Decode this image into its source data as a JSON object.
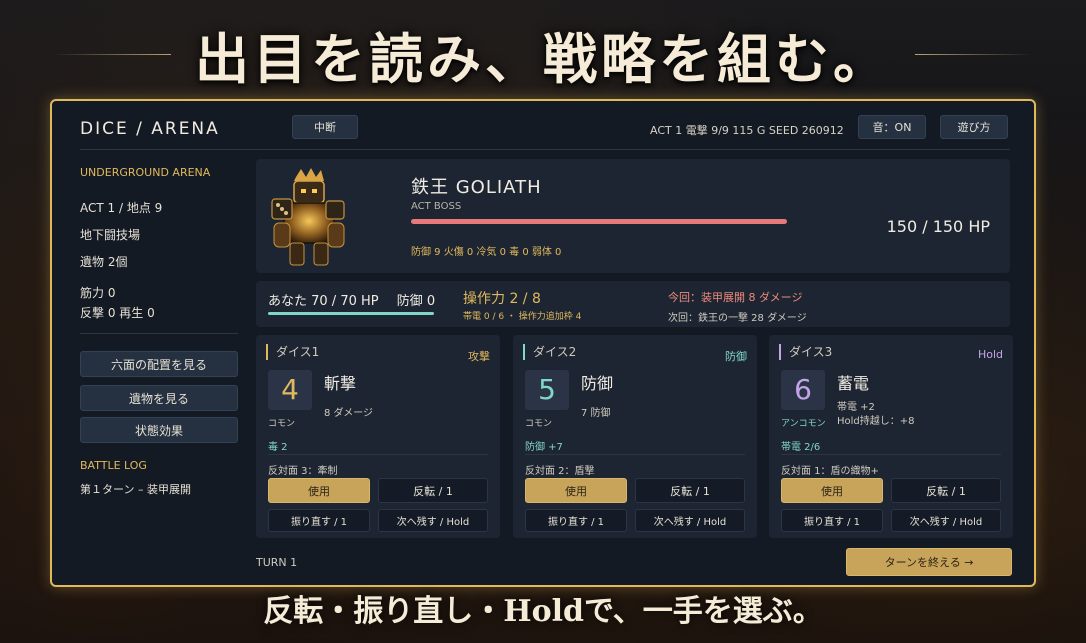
{
  "headline": "出目を読み、戦略を組む。",
  "footline": "反転・振り直し・Holdで、一手を選ぶ。",
  "topbar": {
    "brand": "DICE  /  ARENA",
    "pause_label": "中断",
    "stats": "ACT 1  電撃 9/9  115 G   SEED 260912",
    "sound_label": "音：ON",
    "help_label": "遊び方"
  },
  "sidebar": {
    "arena_label": "UNDERGROUND ARENA",
    "act": "ACT 1 / 地点 9",
    "location": "地下闘技場",
    "relics": "遺物 2個",
    "strength": "筋力 0",
    "counter_regen": "反撃 0  再生 0",
    "buttons": [
      "六面の配置を見る",
      "遺物を見る",
      "状態効果"
    ],
    "battle_log_label": "BATTLE LOG",
    "log": [
      "第１ターン – 装甲展開"
    ]
  },
  "enemy": {
    "name": "鉄王  GOLIATH",
    "subtitle": "ACT BOSS",
    "hp_text": "150 / 150 HP",
    "hp_fraction": 1.0,
    "status": "防御 9   火傷 0   冷気 0   毒 0   弱体 0",
    "portrait_icon": "armored-dice-king-icon"
  },
  "player": {
    "hp_label": "あなた  70 / 70 HP",
    "defense_label": "防御 0",
    "hp_fraction": 1.0,
    "ops_label": "操作力  2 / 8",
    "ops_sub": "帯電 0 / 6  ・ 操作力追加枠 4",
    "intent_now": "今回：装甲展開  8 ダメージ",
    "intent_next": "次回：鉄王の一撃  28 ダメージ"
  },
  "dice": [
    {
      "title": "ダイス1",
      "type": "攻撃",
      "value": "4",
      "rarity": "コモン",
      "skill": "斬撃",
      "effects": [
        "8 ダメージ"
      ],
      "tag": "毒 2",
      "opposite": "反対面 3：牽制",
      "use": "使用",
      "flip": "反転  / 1",
      "reroll": "振り直す / 1",
      "hold": "次へ残す / Hold",
      "accent": "#e0b95c",
      "value_color": "#e0b95c",
      "rarity_color": "#cfcabc"
    },
    {
      "title": "ダイス2",
      "type": "防御",
      "value": "5",
      "rarity": "コモン",
      "skill": "防御",
      "effects": [
        "7 防御"
      ],
      "tag": "防御 +7",
      "opposite": "反対面 2：盾撃",
      "use": "使用",
      "flip": "反転  / 1",
      "reroll": "振り直す / 1",
      "hold": "次へ残す / Hold",
      "accent": "#82d6c8",
      "value_color": "#82d6c8",
      "rarity_color": "#cfcabc"
    },
    {
      "title": "ダイス3",
      "type": "Hold",
      "value": "6",
      "rarity": "アンコモン",
      "skill": "蓄電",
      "effects": [
        "帯電 +2",
        "Hold持越し：+8"
      ],
      "tag": "帯電 2/6",
      "opposite": "反対面 1：盾の織物+",
      "use": "使用",
      "flip": "反転  / 1",
      "reroll": "振り直す / 1",
      "hold": "次へ残す / Hold",
      "accent": "#c4a4e8",
      "value_color": "#c4a4e8",
      "rarity_color": "#82d6c8"
    }
  ],
  "turn_label": "TURN 1",
  "end_turn_label": "ターンを終える  →"
}
